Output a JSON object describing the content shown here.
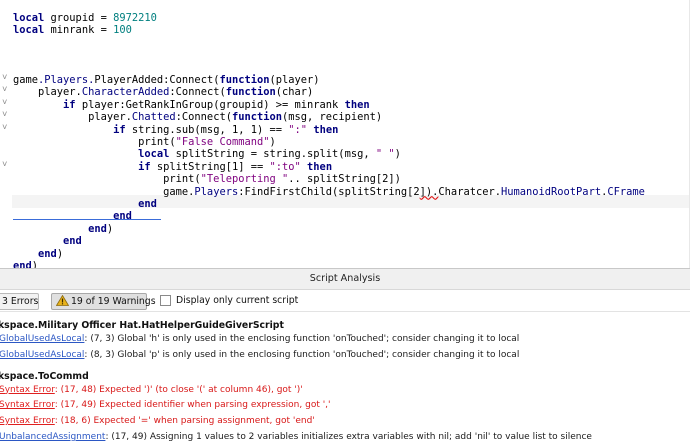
{
  "editor": {
    "lines": [
      [
        {
          "t": "local",
          "c": "kw"
        },
        {
          "t": " groupid = ",
          "c": "plain"
        },
        {
          "t": "8972210",
          "c": "num"
        }
      ],
      [
        {
          "t": "local",
          "c": "kw"
        },
        {
          "t": " minrank = ",
          "c": "plain"
        },
        {
          "t": "100",
          "c": "num"
        }
      ],
      [],
      [],
      [],
      [
        {
          "t": "game",
          "c": "plain"
        },
        {
          "t": ".Players.",
          "c": "mem"
        },
        {
          "t": "PlayerAdded:Connect(",
          "c": "plain"
        },
        {
          "t": "function",
          "c": "kw"
        },
        {
          "t": "(player)",
          "c": "plain"
        }
      ],
      [
        {
          "t": "    player.",
          "c": "plain"
        },
        {
          "t": "CharacterAdded",
          "c": "mem"
        },
        {
          "t": ":Connect(",
          "c": "plain"
        },
        {
          "t": "function",
          "c": "kw"
        },
        {
          "t": "(char)",
          "c": "plain"
        }
      ],
      [
        {
          "t": "        ",
          "c": "plain"
        },
        {
          "t": "if",
          "c": "kw"
        },
        {
          "t": " player:GetRankInGroup(groupid) >= minrank ",
          "c": "plain"
        },
        {
          "t": "then",
          "c": "kw"
        }
      ],
      [
        {
          "t": "            player.",
          "c": "plain"
        },
        {
          "t": "Chatted",
          "c": "mem"
        },
        {
          "t": ":Connect(",
          "c": "plain"
        },
        {
          "t": "function",
          "c": "kw"
        },
        {
          "t": "(msg, recipient)",
          "c": "plain"
        }
      ],
      [
        {
          "t": "                ",
          "c": "plain"
        },
        {
          "t": "if",
          "c": "kw"
        },
        {
          "t": " string.sub(msg, 1, 1) == ",
          "c": "plain"
        },
        {
          "t": "\":\"",
          "c": "str"
        },
        {
          "t": " ",
          "c": "plain"
        },
        {
          "t": "then",
          "c": "kw"
        }
      ],
      [
        {
          "t": "                    print(",
          "c": "plain"
        },
        {
          "t": "\"False Command\"",
          "c": "str"
        },
        {
          "t": ")",
          "c": "plain"
        }
      ],
      [
        {
          "t": "                    ",
          "c": "plain"
        },
        {
          "t": "local",
          "c": "kw"
        },
        {
          "t": " splitString = string.split(msg, ",
          "c": "plain"
        },
        {
          "t": "\" \"",
          "c": "str"
        },
        {
          "t": ")",
          "c": "plain"
        }
      ],
      [
        {
          "t": "                    ",
          "c": "plain"
        },
        {
          "t": "if",
          "c": "kw"
        },
        {
          "t": " splitString[1] == ",
          "c": "plain"
        },
        {
          "t": "\":to\"",
          "c": "str"
        },
        {
          "t": " ",
          "c": "plain"
        },
        {
          "t": "then",
          "c": "kw"
        }
      ],
      [
        {
          "t": "                        print(",
          "c": "plain"
        },
        {
          "t": "\"Teleporting \"",
          "c": "str"
        },
        {
          "t": ".. splitString[2])",
          "c": "plain"
        }
      ],
      [
        {
          "t": "                        game.",
          "c": "plain"
        },
        {
          "t": "Players",
          "c": "mem"
        },
        {
          "t": ":FindFirstChild(splitString[2",
          "c": "plain"
        },
        {
          "t": "]).",
          "c": "err"
        },
        {
          "t": "Charatcer.",
          "c": "plain"
        },
        {
          "t": "HumanoidRootPart",
          "c": "mem"
        },
        {
          "t": ".",
          "c": "plain"
        },
        {
          "t": "CFrame",
          "c": "mem"
        }
      ],
      [
        {
          "t": "                    ",
          "c": "plain"
        },
        {
          "t": "end",
          "c": "kw"
        }
      ],
      [
        {
          "t": "                ",
          "c": "plain"
        },
        {
          "t": "end",
          "c": "kw"
        }
      ],
      [
        {
          "t": "            ",
          "c": "plain"
        },
        {
          "t": "end",
          "c": "kw"
        },
        {
          "t": ")",
          "c": "plain"
        }
      ],
      [
        {
          "t": "        ",
          "c": "plain"
        },
        {
          "t": "end",
          "c": "kw"
        }
      ],
      [
        {
          "t": "    ",
          "c": "plain"
        },
        {
          "t": "end",
          "c": "kw"
        },
        {
          "t": ")",
          "c": "plain"
        }
      ],
      [
        {
          "t": "end",
          "c": "kw"
        },
        {
          "t": ")",
          "c": "plain"
        }
      ]
    ],
    "fold_marks": [
      5,
      6,
      7,
      8,
      9,
      12
    ]
  },
  "colors": {
    "keyword": "#00007f",
    "number": "#007f7f",
    "string": "#7f007f",
    "error_red": "#d81818",
    "link_blue": "#2b57c4"
  },
  "analysis": {
    "title": "Script Analysis",
    "errors_button": "3 Errors",
    "warnings_button": "19 of 19 Warnings",
    "only_current_label": "Display only current script",
    "only_current_checked": false,
    "groups": [
      {
        "header": "kspace.Military Officer Hat.HatHelperGuideGiverScript",
        "rows": [
          {
            "kind": "warn",
            "code": "GlobalUsedAsLocal",
            "msg": ": (7, 3) Global 'h' is only used in the enclosing function 'onTouched'; consider changing it to local"
          },
          {
            "kind": "warn",
            "code": "GlobalUsedAsLocal",
            "msg": ": (8, 3) Global 'p' is only used in the enclosing function 'onTouched'; consider changing it to local"
          }
        ]
      },
      {
        "header": "kspace.ToCommd",
        "rows": [
          {
            "kind": "err",
            "code": "Syntax Error",
            "msg": ": (17, 48) Expected ')' (to close '(' at column 46), got ')'"
          },
          {
            "kind": "err",
            "code": "Syntax Error",
            "msg": ": (17, 49) Expected identifier when parsing expression, got ','"
          },
          {
            "kind": "err",
            "code": "Syntax Error",
            "msg": ": (18, 6) Expected '=' when parsing assignment, got 'end'"
          },
          {
            "kind": "unbal",
            "code": "UnbalancedAssignment",
            "msg": ": (17, 49) Assigning 1 values to 2 variables initializes extra variables with nil; add 'nil' to value list to silence"
          }
        ]
      }
    ]
  }
}
